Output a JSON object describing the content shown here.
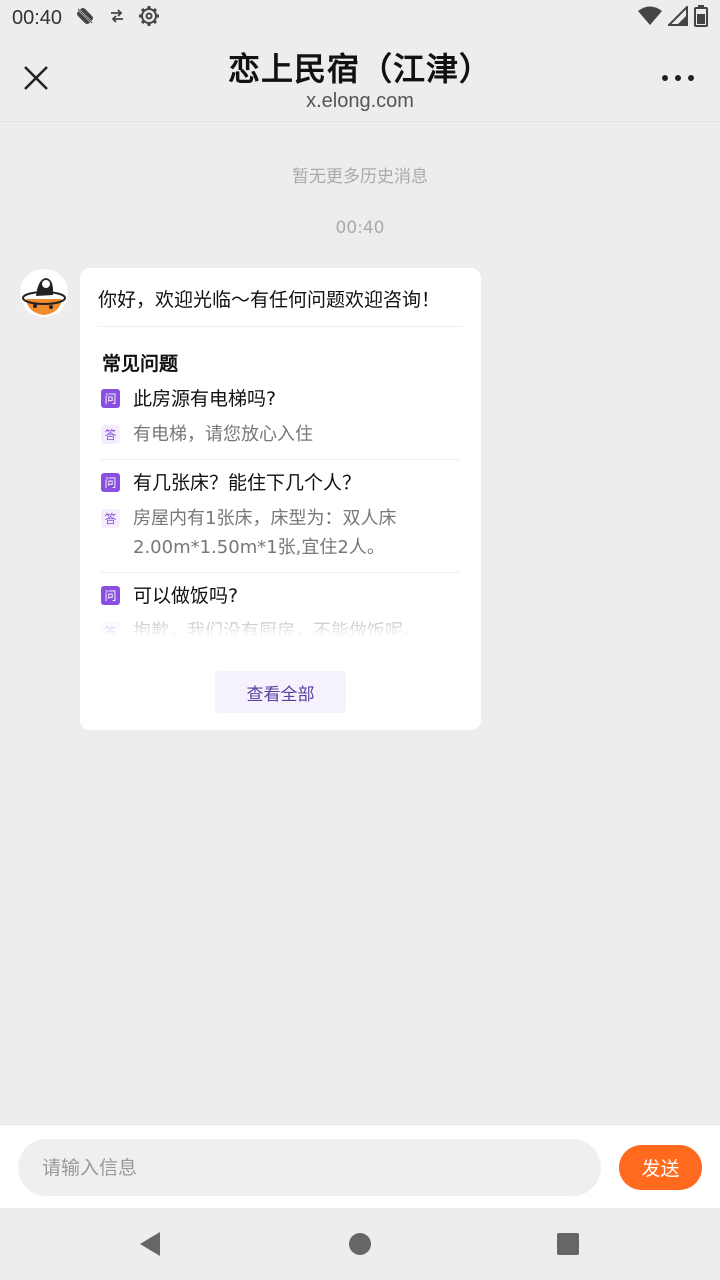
{
  "status_bar": {
    "time": "00:40",
    "icons": [
      "notification-muted-icon",
      "data-sync-icon",
      "settings-gear-icon",
      "wifi-icon",
      "cellular-signal-icon",
      "battery-icon"
    ]
  },
  "header": {
    "title": "恋上民宿（江津）",
    "subtitle": "x.elong.com",
    "close_icon": "close-icon",
    "more_icon": "more-options-icon"
  },
  "chat": {
    "no_more_history": "暂无更多历史消息",
    "timestamp": "00:40",
    "bubble": {
      "greeting": "你好，欢迎光临～有任何问题欢迎咨询！",
      "faq_title": "常见问题",
      "q_badge": "问",
      "a_badge": "答",
      "faqs": [
        {
          "question": "此房源有电梯吗?",
          "answer": "有电梯，请您放心入住"
        },
        {
          "question": "有几张床？能住下几个人？",
          "answer": "房屋内有1张床，床型为：双人床2.00m*1.50m*1张,宜住2人。"
        },
        {
          "question": "可以做饭吗?",
          "answer": "抱歉，我们没有厨房，不能做饭呢。"
        }
      ],
      "view_all_label": "查看全部"
    }
  },
  "input_bar": {
    "placeholder": "请输入信息",
    "value": "",
    "send_label": "发送"
  },
  "colors": {
    "accent_purple": "#8a4fe0",
    "send_orange": "#ff6a1f",
    "background": "#ededed"
  }
}
